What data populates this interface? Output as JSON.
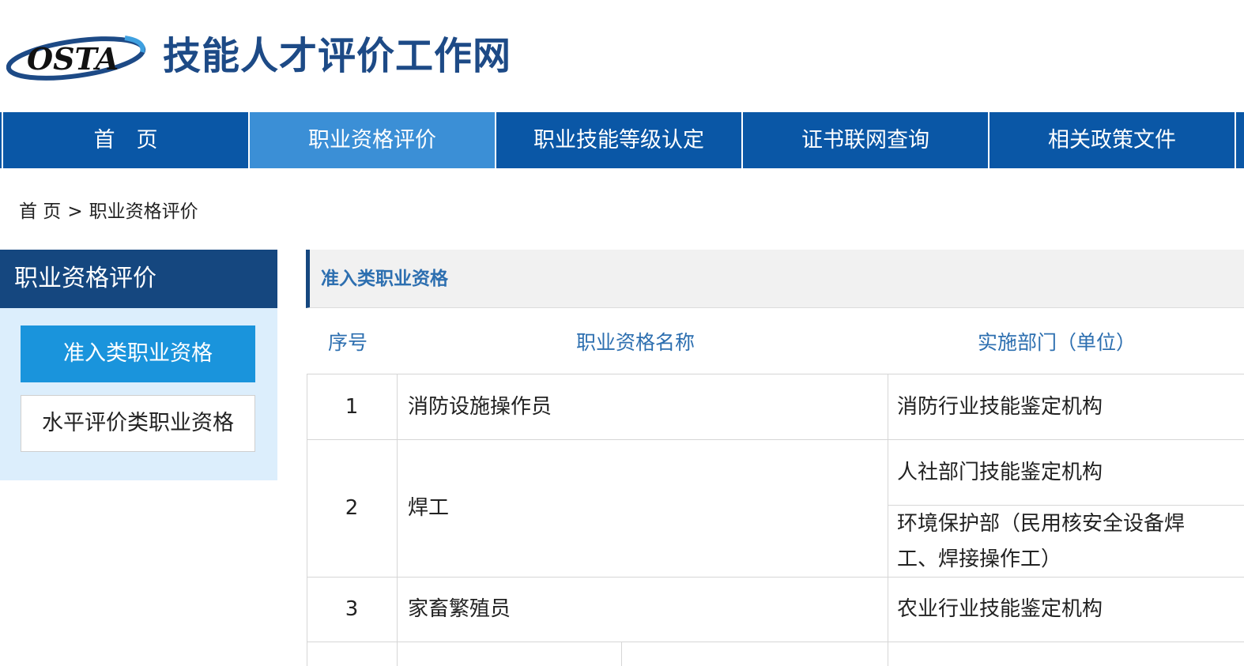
{
  "header": {
    "logo_text": "OSTA",
    "site_title": "技能人才评价工作网"
  },
  "nav": {
    "items": [
      {
        "label": "首　页"
      },
      {
        "label": "职业资格评价"
      },
      {
        "label": "职业技能等级认定"
      },
      {
        "label": "证书联网查询"
      },
      {
        "label": "相关政策文件"
      }
    ],
    "active_index": 1
  },
  "breadcrumb": {
    "home": "首 页",
    "separator": ">",
    "current": "职业资格评价"
  },
  "sidebar": {
    "title": "职业资格评价",
    "items": [
      {
        "label": "准入类职业资格"
      },
      {
        "label": "水平评价类职业资格"
      }
    ]
  },
  "content": {
    "section_title": "准入类职业资格",
    "columns": [
      "序号",
      "职业资格名称",
      "实施部门（单位）"
    ],
    "rows": [
      {
        "no": "1",
        "name": "消防设施操作员",
        "depts": [
          "消防行业技能鉴定机构"
        ]
      },
      {
        "no": "2",
        "name": "焊工",
        "depts": [
          "人社部门技能鉴定机构",
          "环境保护部（民用核安全设备焊工、焊接操作工）"
        ]
      },
      {
        "no": "3",
        "name": "家畜繁殖员",
        "depts": [
          "农业行业技能鉴定机构"
        ]
      }
    ]
  },
  "colors": {
    "nav_bg": "#0a57a6",
    "nav_active": "#3b8fd6",
    "brand_dark": "#15477f",
    "sidebar_active": "#1a94dc",
    "sidebar_bg": "#dceefc",
    "table_header_text": "#2d6fb0"
  }
}
